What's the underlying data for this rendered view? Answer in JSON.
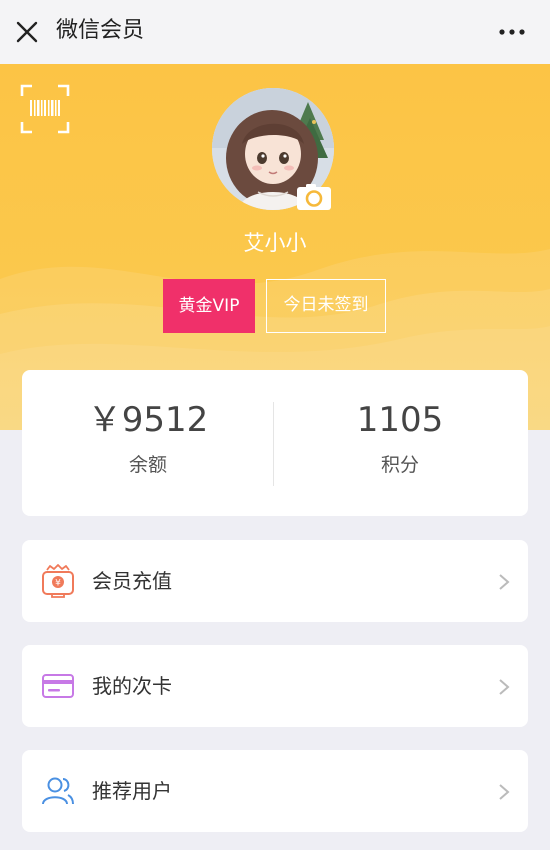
{
  "header": {
    "title": "微信会员"
  },
  "profile": {
    "name": "艾小小",
    "vip_label": "黄金VIP",
    "signin_label": "今日未签到"
  },
  "stats": [
    {
      "value": "￥9512",
      "label": "余额"
    },
    {
      "value": "1105",
      "label": "积分"
    }
  ],
  "menu": [
    {
      "label": "会员充值",
      "icon": "recharge-icon",
      "color": "#F07A5A"
    },
    {
      "label": "我的次卡",
      "icon": "card-icon",
      "color": "#C779E6"
    },
    {
      "label": "推荐用户",
      "icon": "users-icon",
      "color": "#4A90E2"
    }
  ],
  "colors": {
    "accent_yellow": "#FCC445",
    "vip_pink": "#F0306A"
  }
}
